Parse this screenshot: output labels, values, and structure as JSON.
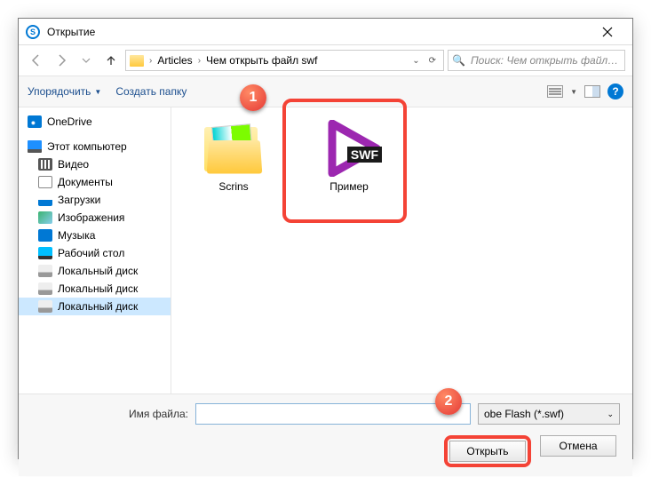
{
  "window": {
    "title": "Открытие"
  },
  "breadcrumb": {
    "seg1": "Articles",
    "seg2": "Чем открыть файл swf"
  },
  "search": {
    "placeholder": "Поиск: Чем открыть файл swf"
  },
  "toolbar": {
    "organize": "Упорядочить",
    "newfolder": "Создать папку"
  },
  "sidebar": {
    "onedrive": "OneDrive",
    "thispc": "Этот компьютер",
    "video": "Видео",
    "documents": "Документы",
    "downloads": "Загрузки",
    "images": "Изображения",
    "music": "Музыка",
    "desktop": "Рабочий стол",
    "disk1": "Локальный диск",
    "disk2": "Локальный диск",
    "disk3": "Локальный диск"
  },
  "files": {
    "folder": "Scrins",
    "swf": "Пример",
    "swf_badge": "SWF"
  },
  "bottom": {
    "filename_label": "Имя файла:",
    "filename_value": "",
    "filetype": "obe Flash (*.swf)",
    "open": "Открыть",
    "cancel": "Отмена"
  },
  "annotations": {
    "one": "1",
    "two": "2"
  }
}
